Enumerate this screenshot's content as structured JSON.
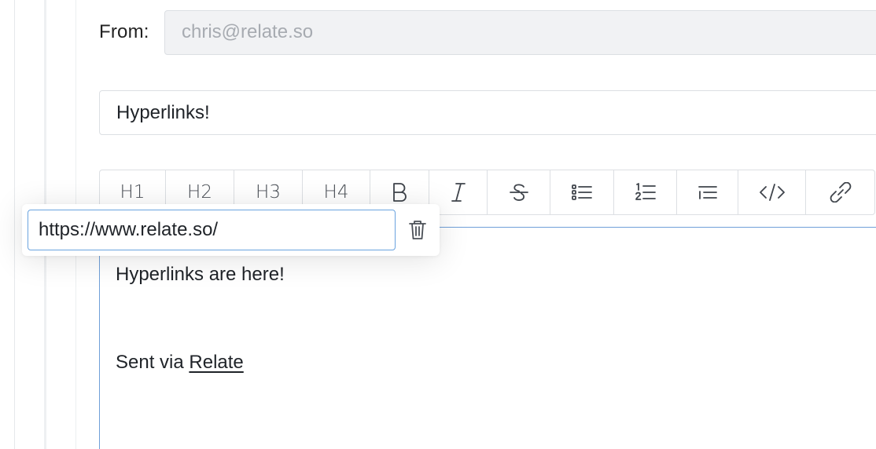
{
  "compose": {
    "from_label": "From:",
    "from_value": "chris@relate.so",
    "subject": "Hyperlinks!",
    "body_text": "Hyperlinks are here!",
    "signature_prefix": "Sent via ",
    "signature_link": "Relate"
  },
  "toolbar": {
    "buttons": [
      {
        "label": "H1",
        "icon": "heading-1-icon"
      },
      {
        "label": "H2",
        "icon": "heading-2-icon"
      },
      {
        "label": "H3",
        "icon": "heading-3-icon"
      },
      {
        "label": "H4",
        "icon": "heading-4-icon"
      },
      {
        "label": "",
        "icon": "bold-icon"
      },
      {
        "label": "",
        "icon": "italic-icon"
      },
      {
        "label": "",
        "icon": "strikethrough-icon"
      },
      {
        "label": "",
        "icon": "bullet-list-icon"
      },
      {
        "label": "",
        "icon": "ordered-list-icon"
      },
      {
        "label": "",
        "icon": "indent-list-icon"
      },
      {
        "label": "",
        "icon": "code-icon"
      },
      {
        "label": "",
        "icon": "link-icon"
      }
    ]
  },
  "link_popover": {
    "url_value": "https://www.relate.so/",
    "delete_icon": "trash-icon"
  },
  "colors": {
    "focus_border": "#6aa3df",
    "field_border": "#dcdfe3",
    "readonly_bg": "#f1f2f4"
  }
}
